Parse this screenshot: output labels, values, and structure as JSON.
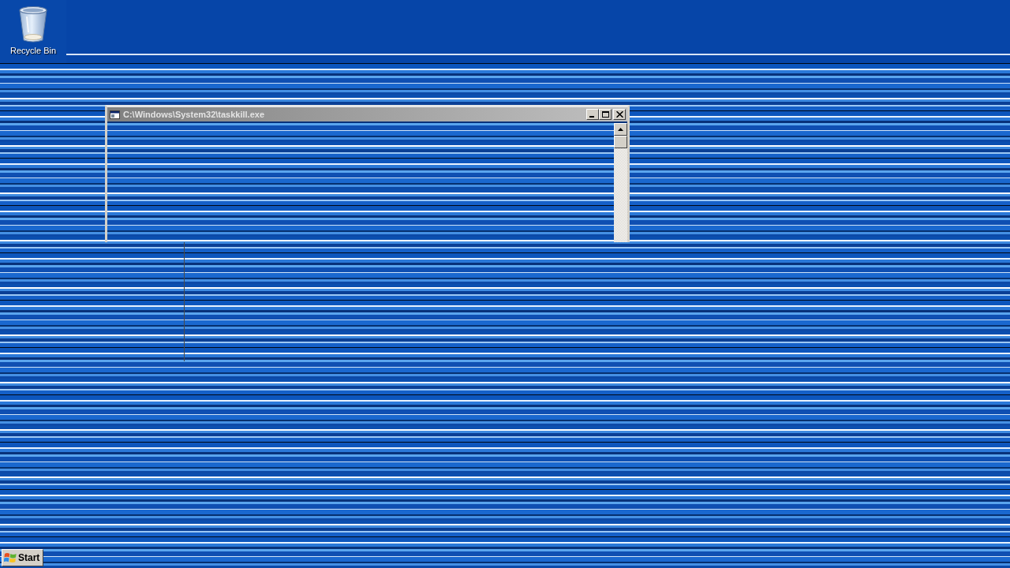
{
  "desktop": {
    "icons": [
      {
        "label": "Recycle Bin"
      }
    ]
  },
  "window": {
    "title": "C:\\Windows\\System32\\taskkill.exe",
    "active": false
  },
  "taskbar": {
    "start_button": "Start"
  }
}
